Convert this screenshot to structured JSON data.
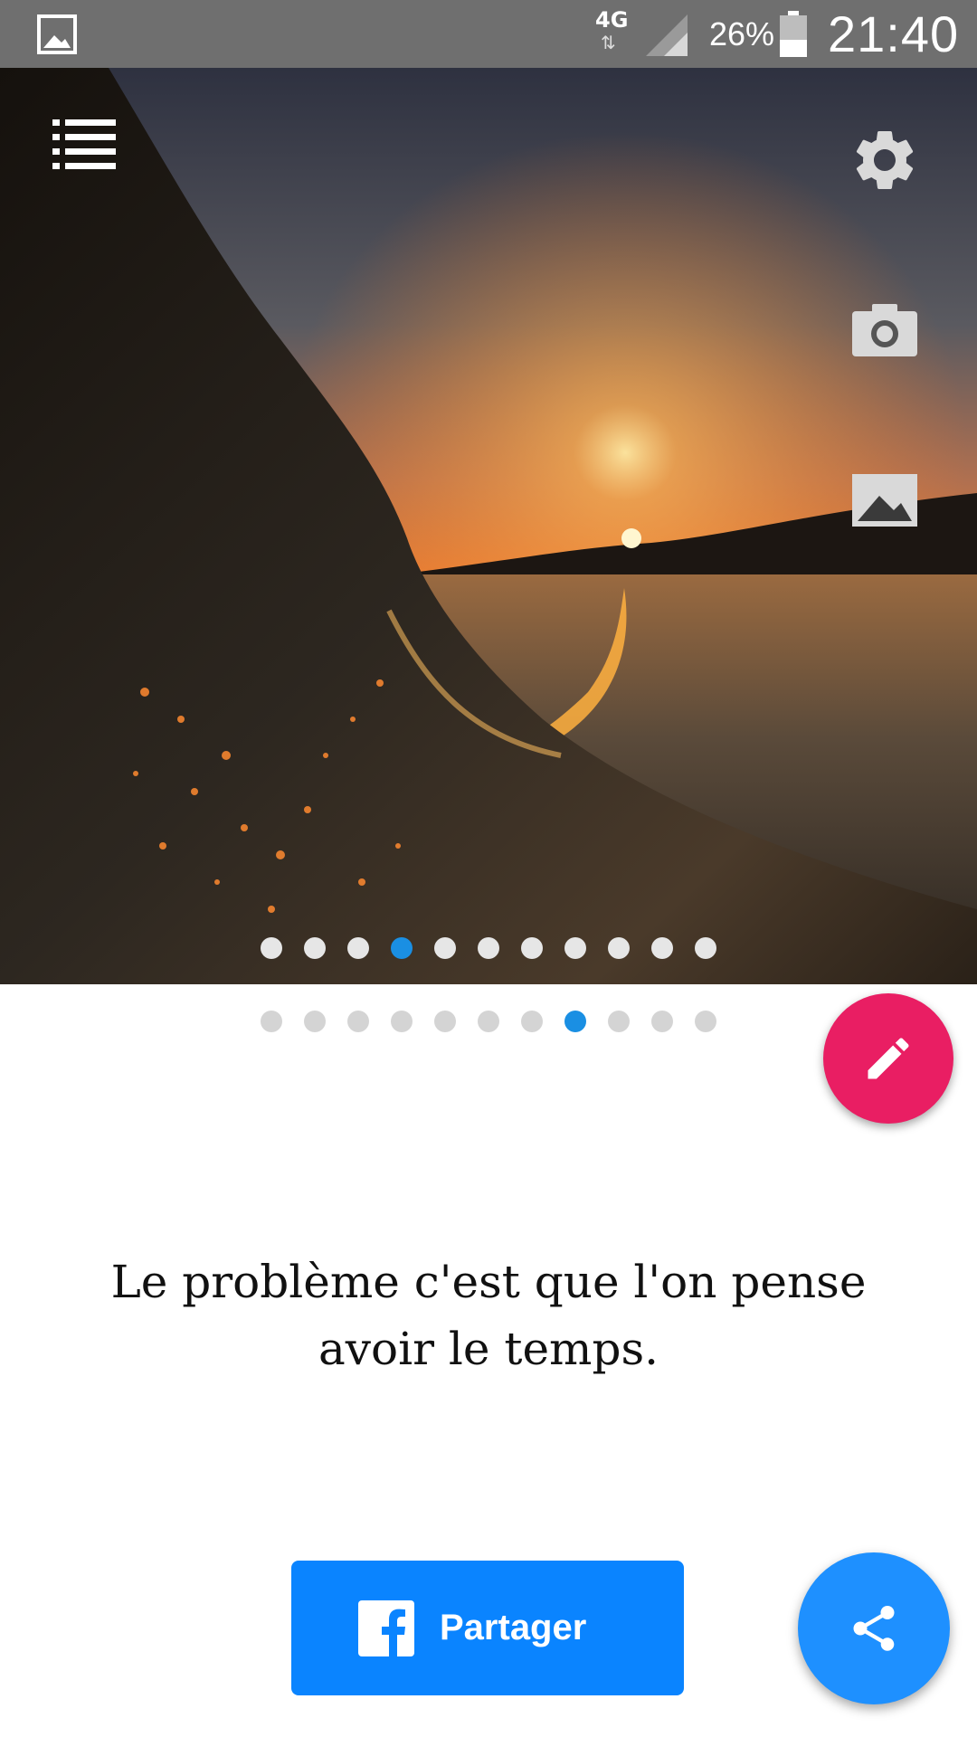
{
  "status_bar": {
    "network_type": "4G",
    "battery_percent": "26%",
    "time": "21:40"
  },
  "hero": {
    "icons": [
      "menu-list-icon",
      "settings-gear-icon",
      "camera-icon",
      "image-icon"
    ],
    "pager": {
      "count": 11,
      "active_index": 3
    }
  },
  "quote_pager": {
    "count": 11,
    "active_index": 7
  },
  "quote": {
    "line1": "Le problème c'est que l'on pense",
    "line2": "avoir le temps."
  },
  "share": {
    "button_label": "Partager",
    "icon": "facebook-icon"
  },
  "colors": {
    "accent_blue": "#0a84ff",
    "dot_active": "#1a8fe3",
    "dot_inactive_hero": "#e6e6e6",
    "dot_inactive_below": "#d4d4d4",
    "fab_edit": "#e91e63",
    "fab_share": "#1e90ff"
  }
}
